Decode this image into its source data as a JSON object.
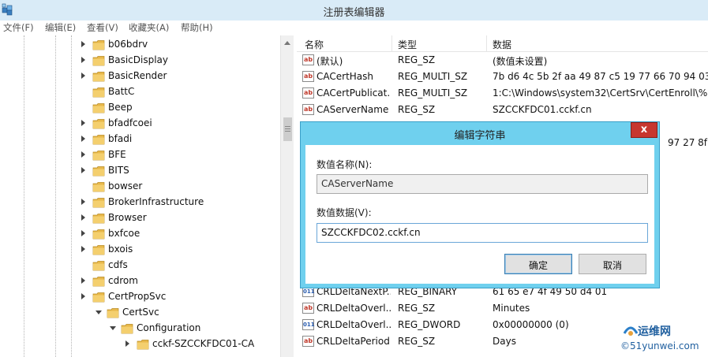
{
  "window": {
    "title": "注册表编辑器"
  },
  "menu": [
    "文件(F)",
    "编辑(E)",
    "查看(V)",
    "收藏夹(A)",
    "帮助(H)"
  ],
  "tree": {
    "items": [
      {
        "label": "b06bdrv",
        "expander": "collapsed"
      },
      {
        "label": "BasicDisplay",
        "expander": "collapsed"
      },
      {
        "label": "BasicRender",
        "expander": "collapsed"
      },
      {
        "label": "BattC",
        "expander": "none"
      },
      {
        "label": "Beep",
        "expander": "none"
      },
      {
        "label": "bfadfcoei",
        "expander": "collapsed"
      },
      {
        "label": "bfadi",
        "expander": "collapsed"
      },
      {
        "label": "BFE",
        "expander": "collapsed"
      },
      {
        "label": "BITS",
        "expander": "collapsed"
      },
      {
        "label": "bowser",
        "expander": "none"
      },
      {
        "label": "BrokerInfrastructure",
        "expander": "collapsed"
      },
      {
        "label": "Browser",
        "expander": "collapsed"
      },
      {
        "label": "bxfcoe",
        "expander": "collapsed"
      },
      {
        "label": "bxois",
        "expander": "collapsed"
      },
      {
        "label": "cdfs",
        "expander": "none"
      },
      {
        "label": "cdrom",
        "expander": "collapsed"
      },
      {
        "label": "CertPropSvc",
        "expander": "collapsed"
      },
      {
        "label": "CertSvc",
        "expander": "expanded"
      },
      {
        "label": "Configuration",
        "expander": "expanded"
      },
      {
        "label": "cckf-SZCCKFDC01-CA",
        "expander": "collapsed"
      }
    ]
  },
  "list": {
    "columns": [
      "名称",
      "类型",
      "数据"
    ],
    "rows": [
      {
        "icon": "string-value-icon",
        "name": "(默认)",
        "type": "REG_SZ",
        "data": "(数值未设置)"
      },
      {
        "icon": "string-value-icon",
        "name": "CACertHash",
        "type": "REG_MULTI_SZ",
        "data": "7b d6 4c 5b 2f aa 49 87 c5 19 77 66 70 94 03.."
      },
      {
        "icon": "string-value-icon",
        "name": "CACertPublicat...",
        "type": "REG_MULTI_SZ",
        "data": "1:C:\\Windows\\system32\\CertSrv\\CertEnroll\\%.."
      },
      {
        "icon": "string-value-icon",
        "name": "CAServerName",
        "type": "REG_SZ",
        "data": "SZCCKFDC01.cckf.cn"
      },
      {
        "icon": "",
        "name": "",
        "type": "",
        "data": "97 27 8f ."
      },
      {
        "icon": "binary-value-icon",
        "name": "CRLDeltaNextP...",
        "type": "REG_BINARY",
        "data": "61 65 e7 4f 49 50 d4 01"
      },
      {
        "icon": "string-value-icon",
        "name": "CRLDeltaOverl...",
        "type": "REG_SZ",
        "data": "Minutes"
      },
      {
        "icon": "binary-value-icon",
        "name": "CRLDeltaOverl...",
        "type": "REG_DWORD",
        "data": "0x00000000 (0)"
      },
      {
        "icon": "string-value-icon",
        "name": "CRLDeltaPeriod",
        "type": "REG_SZ",
        "data": "Days"
      }
    ]
  },
  "dialog": {
    "title": "编辑字符串",
    "close_glyph": "x",
    "name_label": "数值名称(N):",
    "name_value": "CAServerName",
    "data_label": "数值数据(V):",
    "data_value": "SZCCKFDC02.cckf.cn",
    "ok_label": "确定",
    "cancel_label": "取消"
  },
  "watermark": {
    "line1": "运维网",
    "line2": "©51yunwei.com"
  },
  "colors": {
    "titlebar": "#d9ebf7",
    "dialog_frame": "#6fd0ee",
    "close_button": "#c7372f",
    "folder": "#e8b84a"
  }
}
